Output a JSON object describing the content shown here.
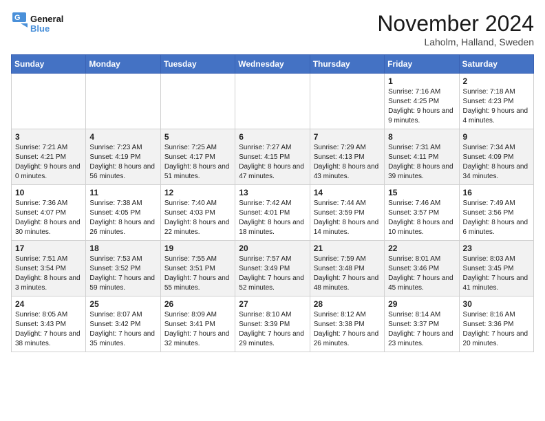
{
  "logo": {
    "line1": "General",
    "line2": "Blue"
  },
  "title": "November 2024",
  "location": "Laholm, Halland, Sweden",
  "days_of_week": [
    "Sunday",
    "Monday",
    "Tuesday",
    "Wednesday",
    "Thursday",
    "Friday",
    "Saturday"
  ],
  "weeks": [
    [
      {
        "day": "",
        "info": ""
      },
      {
        "day": "",
        "info": ""
      },
      {
        "day": "",
        "info": ""
      },
      {
        "day": "",
        "info": ""
      },
      {
        "day": "",
        "info": ""
      },
      {
        "day": "1",
        "info": "Sunrise: 7:16 AM\nSunset: 4:25 PM\nDaylight: 9 hours and 9 minutes."
      },
      {
        "day": "2",
        "info": "Sunrise: 7:18 AM\nSunset: 4:23 PM\nDaylight: 9 hours and 4 minutes."
      }
    ],
    [
      {
        "day": "3",
        "info": "Sunrise: 7:21 AM\nSunset: 4:21 PM\nDaylight: 9 hours and 0 minutes."
      },
      {
        "day": "4",
        "info": "Sunrise: 7:23 AM\nSunset: 4:19 PM\nDaylight: 8 hours and 56 minutes."
      },
      {
        "day": "5",
        "info": "Sunrise: 7:25 AM\nSunset: 4:17 PM\nDaylight: 8 hours and 51 minutes."
      },
      {
        "day": "6",
        "info": "Sunrise: 7:27 AM\nSunset: 4:15 PM\nDaylight: 8 hours and 47 minutes."
      },
      {
        "day": "7",
        "info": "Sunrise: 7:29 AM\nSunset: 4:13 PM\nDaylight: 8 hours and 43 minutes."
      },
      {
        "day": "8",
        "info": "Sunrise: 7:31 AM\nSunset: 4:11 PM\nDaylight: 8 hours and 39 minutes."
      },
      {
        "day": "9",
        "info": "Sunrise: 7:34 AM\nSunset: 4:09 PM\nDaylight: 8 hours and 34 minutes."
      }
    ],
    [
      {
        "day": "10",
        "info": "Sunrise: 7:36 AM\nSunset: 4:07 PM\nDaylight: 8 hours and 30 minutes."
      },
      {
        "day": "11",
        "info": "Sunrise: 7:38 AM\nSunset: 4:05 PM\nDaylight: 8 hours and 26 minutes."
      },
      {
        "day": "12",
        "info": "Sunrise: 7:40 AM\nSunset: 4:03 PM\nDaylight: 8 hours and 22 minutes."
      },
      {
        "day": "13",
        "info": "Sunrise: 7:42 AM\nSunset: 4:01 PM\nDaylight: 8 hours and 18 minutes."
      },
      {
        "day": "14",
        "info": "Sunrise: 7:44 AM\nSunset: 3:59 PM\nDaylight: 8 hours and 14 minutes."
      },
      {
        "day": "15",
        "info": "Sunrise: 7:46 AM\nSunset: 3:57 PM\nDaylight: 8 hours and 10 minutes."
      },
      {
        "day": "16",
        "info": "Sunrise: 7:49 AM\nSunset: 3:56 PM\nDaylight: 8 hours and 6 minutes."
      }
    ],
    [
      {
        "day": "17",
        "info": "Sunrise: 7:51 AM\nSunset: 3:54 PM\nDaylight: 8 hours and 3 minutes."
      },
      {
        "day": "18",
        "info": "Sunrise: 7:53 AM\nSunset: 3:52 PM\nDaylight: 7 hours and 59 minutes."
      },
      {
        "day": "19",
        "info": "Sunrise: 7:55 AM\nSunset: 3:51 PM\nDaylight: 7 hours and 55 minutes."
      },
      {
        "day": "20",
        "info": "Sunrise: 7:57 AM\nSunset: 3:49 PM\nDaylight: 7 hours and 52 minutes."
      },
      {
        "day": "21",
        "info": "Sunrise: 7:59 AM\nSunset: 3:48 PM\nDaylight: 7 hours and 48 minutes."
      },
      {
        "day": "22",
        "info": "Sunrise: 8:01 AM\nSunset: 3:46 PM\nDaylight: 7 hours and 45 minutes."
      },
      {
        "day": "23",
        "info": "Sunrise: 8:03 AM\nSunset: 3:45 PM\nDaylight: 7 hours and 41 minutes."
      }
    ],
    [
      {
        "day": "24",
        "info": "Sunrise: 8:05 AM\nSunset: 3:43 PM\nDaylight: 7 hours and 38 minutes."
      },
      {
        "day": "25",
        "info": "Sunrise: 8:07 AM\nSunset: 3:42 PM\nDaylight: 7 hours and 35 minutes."
      },
      {
        "day": "26",
        "info": "Sunrise: 8:09 AM\nSunset: 3:41 PM\nDaylight: 7 hours and 32 minutes."
      },
      {
        "day": "27",
        "info": "Sunrise: 8:10 AM\nSunset: 3:39 PM\nDaylight: 7 hours and 29 minutes."
      },
      {
        "day": "28",
        "info": "Sunrise: 8:12 AM\nSunset: 3:38 PM\nDaylight: 7 hours and 26 minutes."
      },
      {
        "day": "29",
        "info": "Sunrise: 8:14 AM\nSunset: 3:37 PM\nDaylight: 7 hours and 23 minutes."
      },
      {
        "day": "30",
        "info": "Sunrise: 8:16 AM\nSunset: 3:36 PM\nDaylight: 7 hours and 20 minutes."
      }
    ]
  ]
}
